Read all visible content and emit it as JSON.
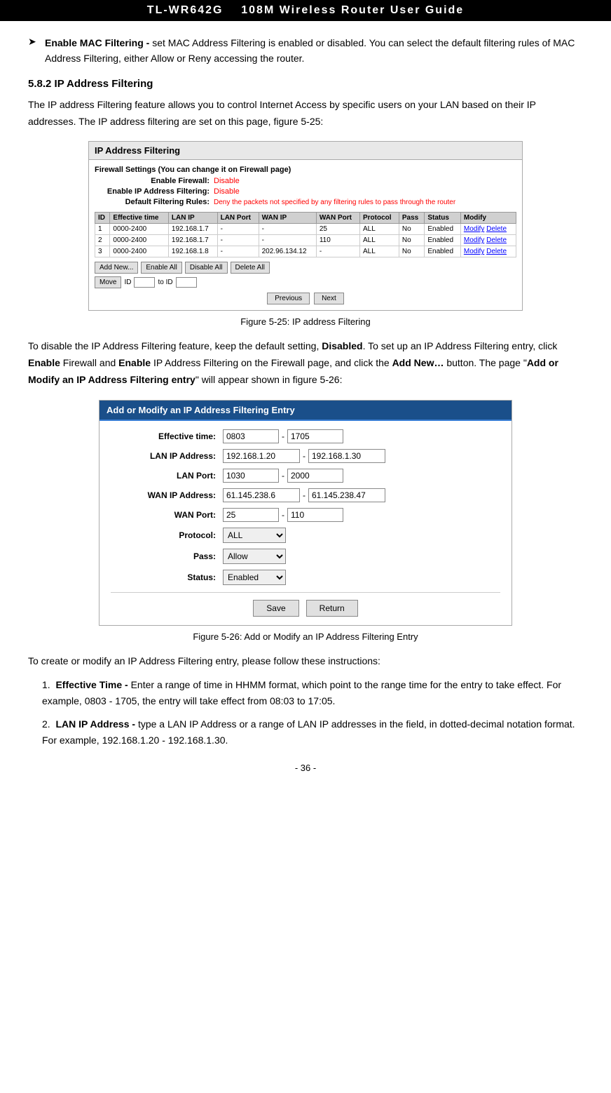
{
  "header": {
    "title": "TL-WR642G",
    "subtitle": "108M  Wireless  Router  User  Guide"
  },
  "bullet_section": {
    "items": [
      {
        "label": "Enable MAC Filtering -",
        "text": " set MAC Address Filtering is enabled or disabled. You can select the default filtering rules of MAC Address Filtering, either Allow or Reny accessing the router."
      }
    ]
  },
  "section_title": "5.8.2 IP Address Filtering",
  "para1": "The IP address Filtering feature allows you to control Internet Access by specific users on your LAN based on their IP addresses. The IP address filtering are set on this page, figure 5-25:",
  "figure1": {
    "caption": "Figure 5-25: IP address Filtering",
    "title": "IP Address Filtering",
    "fw_settings_title": "Firewall Settings (You can change it on Firewall page)",
    "enable_fw_label": "Enable Firewall:",
    "enable_fw_value": "Disable",
    "enable_ip_label": "Enable IP Address Filtering:",
    "enable_ip_value": "Disable",
    "default_rules_label": "Default Filtering Rules:",
    "default_rules_value": "Deny the packets not specified by any filtering rules to pass through the router",
    "table": {
      "columns": [
        "ID",
        "Effective time",
        "LAN IP",
        "LAN Port",
        "WAN IP",
        "WAN Port",
        "Protocol",
        "Pass",
        "Status",
        "Modify"
      ],
      "rows": [
        [
          "1",
          "0000-2400",
          "192.168.1.7",
          "-",
          "-",
          "25",
          "ALL",
          "No",
          "Enabled",
          "Modify Delete"
        ],
        [
          "2",
          "0000-2400",
          "192.168.1.7",
          "-",
          "-",
          "110",
          "ALL",
          "No",
          "Enabled",
          "Modify Delete"
        ],
        [
          "3",
          "0000-2400",
          "192.168.1.8",
          "-",
          "202.96.134.12",
          "-",
          "ALL",
          "No",
          "Enabled",
          "Modify Delete"
        ]
      ]
    },
    "buttons": {
      "add_new": "Add New...",
      "enable_all": "Enable All",
      "disable_all": "Disable All",
      "delete_all": "Delete All",
      "move": "Move",
      "id_label": "ID",
      "to_id_label": "to ID",
      "previous": "Previous",
      "next": "Next"
    }
  },
  "para2_parts": {
    "pre": "To disable the IP Address Filtering feature, keep the default setting, ",
    "disabled": "Disabled",
    "mid1": ". To set up an IP Address Filtering entry, click ",
    "enable1": "Enable",
    "mid2": " Firewall and ",
    "enable2": "Enable",
    "mid3": " IP Address Filtering on the Firewall page, and click the ",
    "add_new": "Add New…",
    "mid4": " button. The page \"",
    "add_modify": "Add or Modify an IP Address Filtering entry",
    "post": "\" will appear shown in figure 5-26:"
  },
  "figure2": {
    "caption": "Figure 5-26: Add or Modify an IP Address Filtering Entry",
    "title": "Add or Modify an IP Address Filtering Entry",
    "fields": {
      "effective_time_label": "Effective time:",
      "effective_time_from": "0803",
      "effective_time_to": "1705",
      "lan_ip_label": "LAN IP Address:",
      "lan_ip_from": "192.168.1.20",
      "lan_ip_to": "192.168.1.30",
      "lan_port_label": "LAN Port:",
      "lan_port_from": "1030",
      "lan_port_to": "2000",
      "wan_ip_label": "WAN IP Address:",
      "wan_ip_from": "61.145.238.6",
      "wan_ip_to": "61.145.238.47",
      "wan_port_label": "WAN Port:",
      "wan_port_from": "25",
      "wan_port_to": "110",
      "protocol_label": "Protocol:",
      "protocol_value": "ALL",
      "pass_label": "Pass:",
      "pass_value": "Allow",
      "status_label": "Status:",
      "status_value": "Enabled",
      "save_btn": "Save",
      "return_btn": "Return"
    }
  },
  "para3": "To create or modify an IP Address Filtering entry, please follow these instructions:",
  "instructions": [
    {
      "number": "1.",
      "label": "Effective Time -",
      "text": " Enter a range of time in HHMM format, which point to the range time for the entry to take effect. For example, 0803 - 1705, the entry will take effect from 08:03 to 17:05."
    },
    {
      "number": "2.",
      "label": "LAN IP Address -",
      "text": " type a LAN IP Address or a range of LAN IP addresses in the field, in dotted-decimal notation format. For example, 192.168.1.20 - 192.168.1.30."
    }
  ],
  "footer": {
    "page": "- 36 -"
  }
}
